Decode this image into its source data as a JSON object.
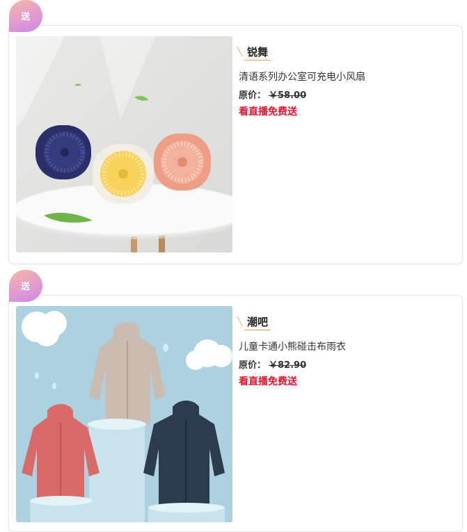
{
  "items": [
    {
      "badge": "送",
      "shop": "锐舞",
      "title": "清语系列办公室可充电小风扇",
      "price_label": "原价：",
      "price": "￥58.00",
      "promo": "看直播免费送",
      "image": "desk-fans-photo"
    },
    {
      "badge": "送",
      "shop": "潮吧",
      "title": "儿童卡通小熊碰击布雨衣",
      "price_label": "原价：",
      "price": "￥82.90",
      "promo": "看直播免费送",
      "image": "raincoats-photo"
    }
  ],
  "colors": {
    "promo": "#e8112d",
    "accent": "#f0a64a"
  }
}
